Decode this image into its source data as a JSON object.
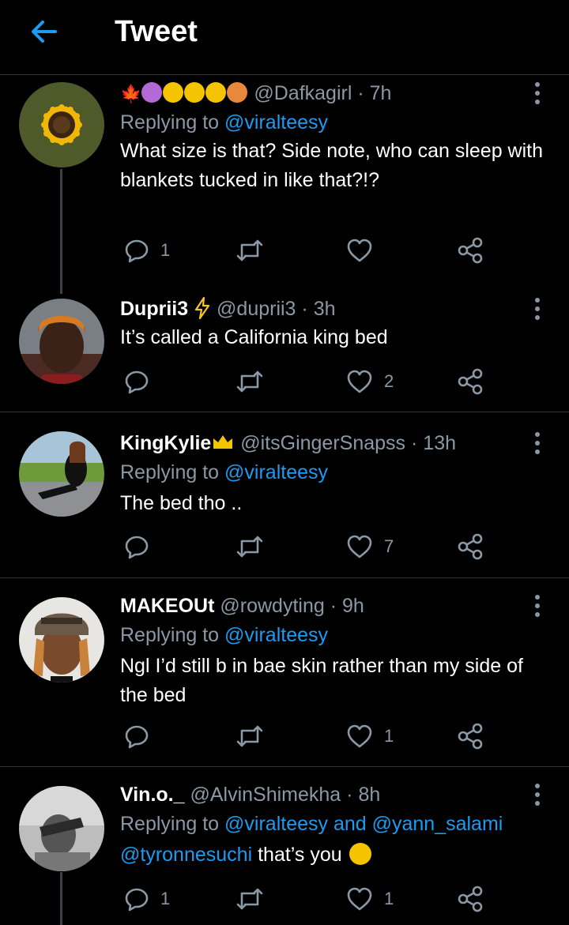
{
  "header": {
    "title": "Tweet"
  },
  "colors": {
    "accent": "#1d9bf0",
    "muted": "#8b98a5",
    "background": "#000000",
    "divider": "#2f3336"
  },
  "tweets": [
    {
      "name": "",
      "handle": "@Dafkagirl",
      "time": "· 7h",
      "replying_prefix": "Replying to",
      "replying_to": "@viralteesy",
      "text": "What size is that? Side note, who can sleep with blankets tucked in like that?!?",
      "replies": "1",
      "retweets": "",
      "likes": ""
    },
    {
      "name": "Duprii3",
      "handle": "@duprii3",
      "time": "· 3h",
      "text": "It’s called a California king bed",
      "replies": "",
      "retweets": "",
      "likes": "2"
    },
    {
      "name": "KingKylie",
      "handle": "@itsGingerSnapss",
      "time": "· 13h",
      "replying_prefix": "Replying to",
      "replying_to": "@viralteesy",
      "text": "The bed tho ..",
      "replies": "",
      "retweets": "",
      "likes": "7"
    },
    {
      "name": "MAKEOUt",
      "handle": "@rowdyting",
      "time": "· 9h",
      "replying_prefix": "Replying to",
      "replying_to": "@viralteesy",
      "text": "Ngl I’d still b in bae skin rather than my side of the bed",
      "replies": "",
      "retweets": "",
      "likes": "1"
    },
    {
      "name": "Vin.o._",
      "handle": "@AlvinShimekha",
      "time": "· 8h",
      "replying_prefix": "Replying to",
      "replying_to": "@viralteesy and @yann_salami",
      "mention": "@tyronnesuchi",
      "text": "that’s you",
      "replies": "1",
      "retweets": "",
      "likes": "1"
    }
  ],
  "icons": {
    "back": "arrow-left-icon",
    "reply": "reply-icon",
    "retweet": "retweet-icon",
    "like": "heart-icon",
    "share": "share-icon",
    "more": "more-vertical-icon"
  }
}
